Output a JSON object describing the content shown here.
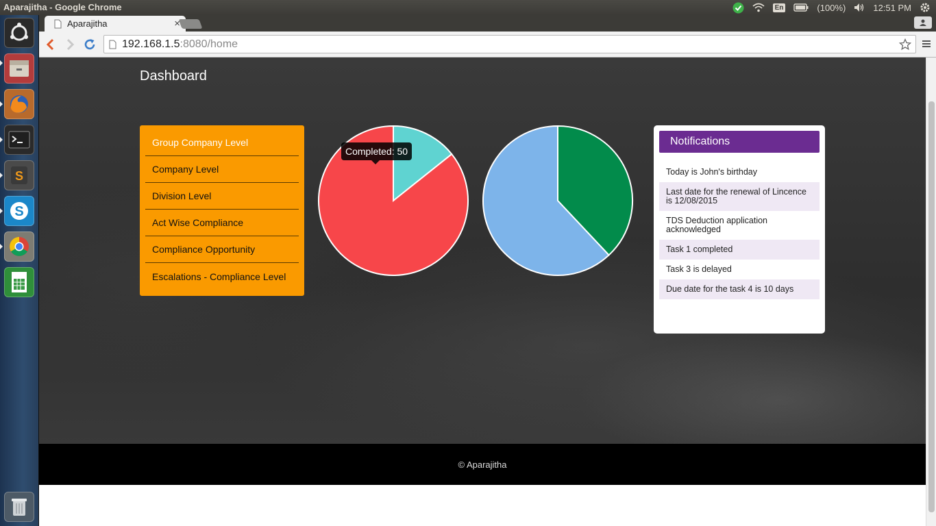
{
  "os": {
    "window_title": "Aparajitha - Google Chrome",
    "language": "En",
    "battery": "(100%)",
    "clock": "12:51 PM"
  },
  "browser": {
    "tab_title": "Aparajitha",
    "tab_close": "×",
    "url_host": "192.168.1.5",
    "url_rest": ":8080/home"
  },
  "page": {
    "title": "Dashboard",
    "menu": [
      {
        "label": "Group Company Level"
      },
      {
        "label": "Company Level"
      },
      {
        "label": "Division Level"
      },
      {
        "label": "Act Wise Compliance"
      },
      {
        "label": "Compliance Opportunity"
      },
      {
        "label": "Escalations - Compliance Level"
      }
    ],
    "tooltip": "Completed: 50",
    "notifications": {
      "title": "Notifications",
      "items": [
        {
          "text": "Today is John's birthday"
        },
        {
          "text": "Last date for the renewal of Lincence is 12/08/2015"
        },
        {
          "text": "TDS Deduction application acknowledged"
        },
        {
          "text": "Task 1 completed"
        },
        {
          "text": "Task 3 is delayed"
        },
        {
          "text": "Due date for the task 4 is 10 days"
        }
      ]
    },
    "footer": "© Aparajitha"
  },
  "chart_data": [
    {
      "type": "pie",
      "slices": [
        {
          "label": "Completed",
          "value": 50,
          "color": "#5fd3d1"
        },
        {
          "value": 300,
          "color": "#f7464a"
        }
      ]
    },
    {
      "type": "pie",
      "slices": [
        {
          "value": 38,
          "color": "#028b4b"
        },
        {
          "value": 62,
          "color": "#7db4ea"
        }
      ]
    }
  ]
}
